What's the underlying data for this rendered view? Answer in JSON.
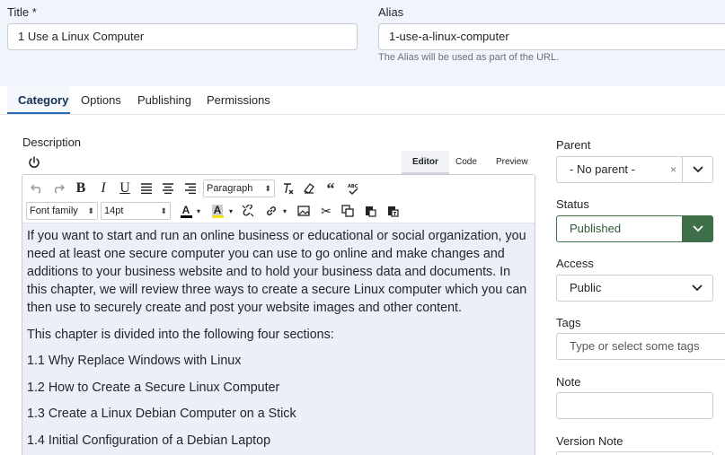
{
  "form": {
    "title_label": "Title *",
    "title_value": "1 Use a Linux Computer",
    "alias_label": "Alias",
    "alias_value": "1-use-a-linux-computer",
    "alias_hint": "The Alias will be used as part of the URL."
  },
  "tabs": [
    {
      "label": "Category",
      "active": true
    },
    {
      "label": "Options"
    },
    {
      "label": "Publishing"
    },
    {
      "label": "Permissions"
    }
  ],
  "editor": {
    "description_label": "Description",
    "modes": [
      "Editor",
      "Code",
      "Preview"
    ],
    "format_value": "Paragraph",
    "font_family_value": "Font family",
    "font_size_value": "14pt",
    "paragraphs": [
      "If you want to start and run an online business or educational or social organization, you need at least one secure computer you can use to go online and make changes and additions to your business website and to hold your business data and documents. In this chapter, we will review three ways to create a secure Linux computer which you can then use to securely create and post your website images and other content.",
      "This chapter is divided into the following four sections:",
      "1.1 Why Replace Windows with Linux",
      "1.2 How to Create a Secure Linux Computer",
      "1.3 Create a Linux Debian Computer on a Stick",
      "1.4 Initial Configuration of a Debian Laptop"
    ]
  },
  "sidebar": {
    "parent_label": "Parent",
    "parent_value": "- No parent -",
    "status_label": "Status",
    "status_value": "Published",
    "access_label": "Access",
    "access_value": "Public",
    "tags_label": "Tags",
    "tags_placeholder": "Type or select some tags",
    "note_label": "Note",
    "version_note_label": "Version Note"
  },
  "colors": {
    "status_green": "#3f6f48",
    "tab_accent": "#2a69b8",
    "content_bg": "#eceef8"
  }
}
